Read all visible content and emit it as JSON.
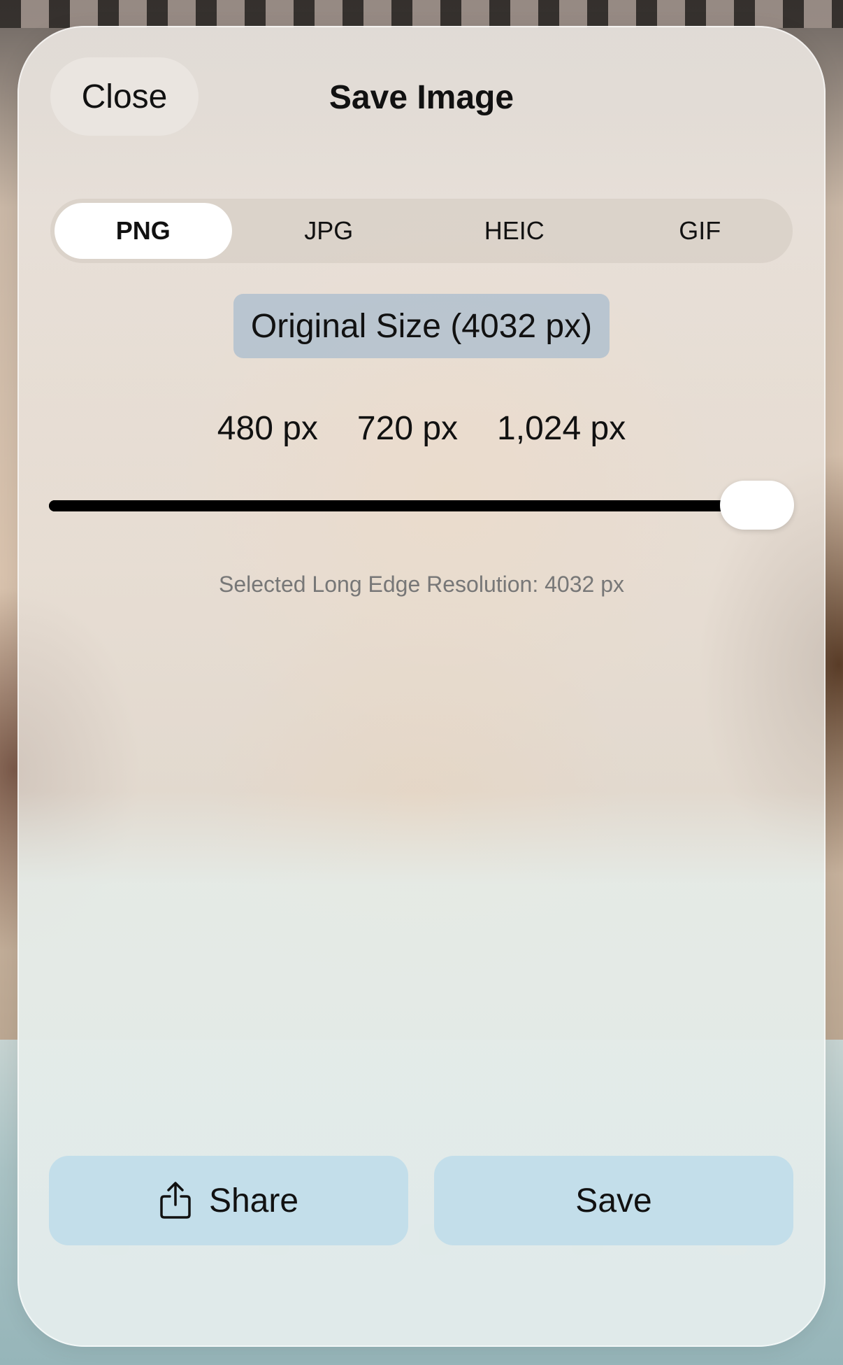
{
  "sheet": {
    "close_label": "Close",
    "title": "Save Image"
  },
  "formats": {
    "options": [
      "PNG",
      "JPG",
      "HEIC",
      "GIF"
    ],
    "selected": "PNG"
  },
  "size": {
    "original_label": "Original Size (4032 px)",
    "presets": [
      "480 px",
      "720 px",
      "1,024 px"
    ],
    "slider_fraction": 1.0,
    "resolution_text": "Selected Long Edge Resolution: 4032 px"
  },
  "actions": {
    "share_label": "Share",
    "save_label": "Save"
  }
}
